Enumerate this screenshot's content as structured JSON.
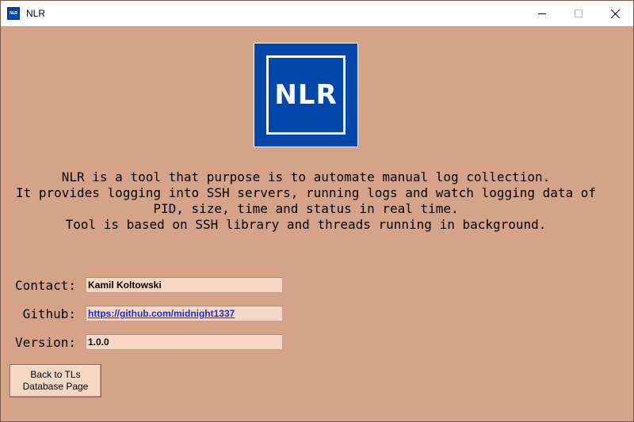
{
  "window": {
    "title": "NLR",
    "icon_name": "nlr-app-icon",
    "icon_text": "NLR",
    "controls": [
      "minimize-icon",
      "maximize-icon",
      "close-icon"
    ]
  },
  "logo": {
    "text": "NLR",
    "background_color": "#0047ab",
    "foreground_color": "#ffffff"
  },
  "description": {
    "lines": [
      "NLR is a tool that purpose is to automate manual log collection.",
      "It provides logging into SSH servers, running logs and watch logging data of",
      "PID, size, time and status in real time.",
      "Tool is based on SSH library and threads running in background."
    ]
  },
  "fields": {
    "contact": {
      "label": "Contact:",
      "value": "Kamil Koltowski"
    },
    "github": {
      "label": "Github:",
      "value": "https://github.com/midnight1337"
    },
    "version": {
      "label": "Version:",
      "value": "1.0.0"
    }
  },
  "back_button": {
    "label": "Back to TLs\nDatabase Page"
  },
  "colors": {
    "background": "#d5a387",
    "field_background": "#f6d7c4",
    "link": "#1a2fd6"
  }
}
